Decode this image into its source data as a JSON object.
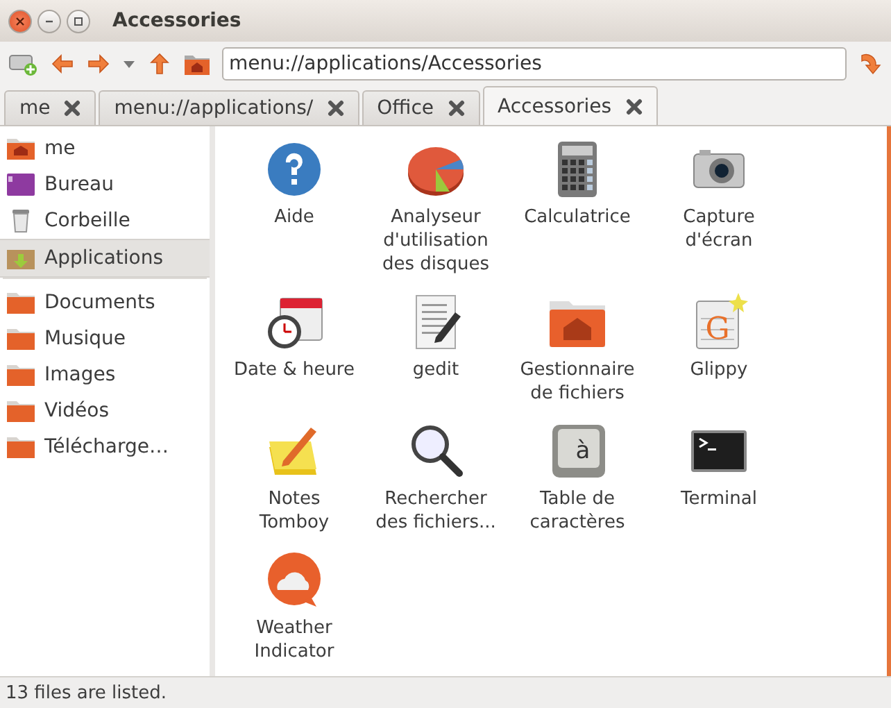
{
  "window": {
    "title": "Accessories"
  },
  "location": {
    "value": "menu://applications/Accessories"
  },
  "tabs": [
    {
      "label": "me",
      "selected": false
    },
    {
      "label": "menu://applications/",
      "selected": false
    },
    {
      "label": "Office",
      "selected": false
    },
    {
      "label": "Accessories",
      "selected": true
    }
  ],
  "sidebar": {
    "items": [
      {
        "label": "me",
        "selected": false
      },
      {
        "label": "Bureau",
        "selected": false
      },
      {
        "label": "Corbeille",
        "selected": false
      },
      {
        "label": "Applications",
        "selected": true
      },
      {
        "label": "Documents",
        "selected": false
      },
      {
        "label": "Musique",
        "selected": false
      },
      {
        "label": "Images",
        "selected": false
      },
      {
        "label": "Vidéos",
        "selected": false
      },
      {
        "label": "Télécharge…",
        "selected": false
      }
    ]
  },
  "files": [
    {
      "label": "Aide"
    },
    {
      "label": "Analyseur\nd'utilisation\ndes disques"
    },
    {
      "label": "Calculatrice"
    },
    {
      "label": "Capture\nd'écran"
    },
    {
      "label": "Date & heure"
    },
    {
      "label": "gedit"
    },
    {
      "label": "Gestionnaire\nde fichiers"
    },
    {
      "label": "Glippy",
      "icon_text": "G"
    },
    {
      "label": "Notes\nTomboy"
    },
    {
      "label": "Rechercher\ndes fichiers..."
    },
    {
      "label": "Table de\ncaractères",
      "icon_text": "à"
    },
    {
      "label": "Terminal"
    },
    {
      "label": "Weather\nIndicator"
    }
  ],
  "status_bar": {
    "text": "13 files are listed."
  }
}
